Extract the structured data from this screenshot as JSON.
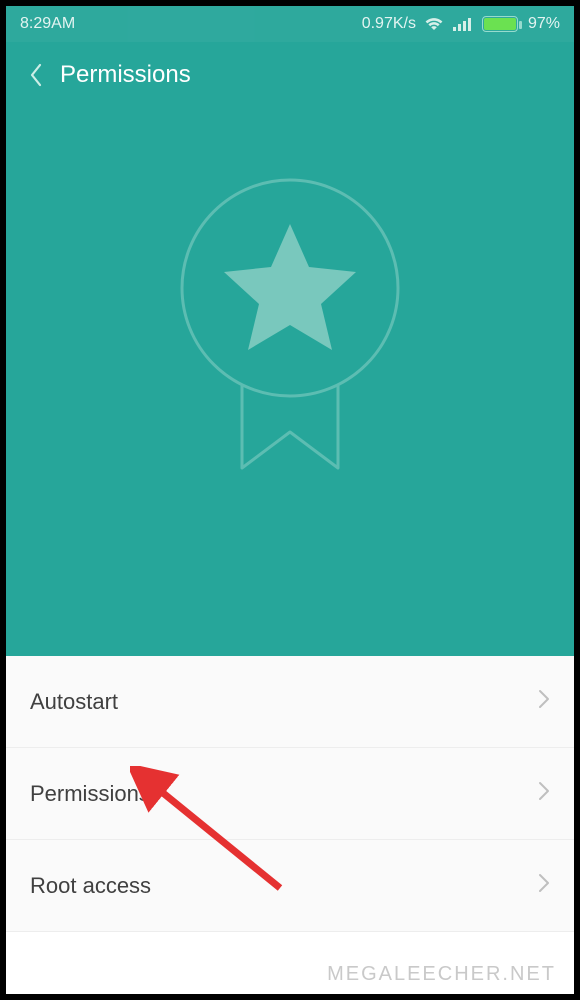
{
  "statusbar": {
    "time": "8:29AM",
    "speed": "0.97K/s",
    "battery_pct": "97%"
  },
  "header": {
    "title": "Permissions"
  },
  "menu": {
    "items": [
      {
        "label": "Autostart"
      },
      {
        "label": "Permissions"
      },
      {
        "label": "Root access"
      }
    ]
  },
  "watermark": "MEGALEECHER.NET"
}
